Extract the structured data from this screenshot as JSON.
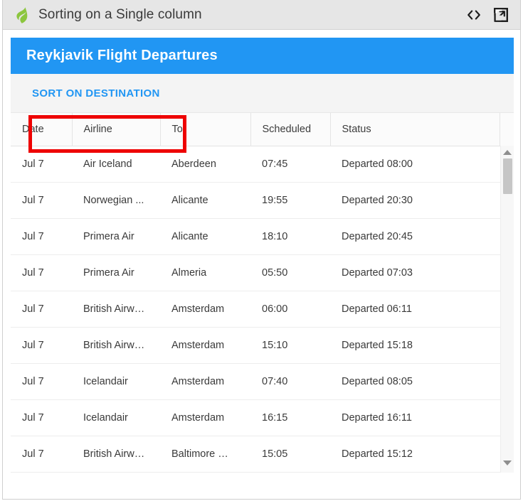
{
  "chrome": {
    "title": "Sorting on a Single column",
    "logo_icon": "green-leaf-logo",
    "actions": [
      {
        "name": "view-source-icon",
        "label": "<>"
      },
      {
        "name": "open-external-icon",
        "label": "open in new window"
      }
    ]
  },
  "panel": {
    "title": "Reykjavik Flight Departures",
    "header_color": "#2196f3",
    "toolbar": {
      "sort_button_label": "SORT ON DESTINATION",
      "sort_button_color": "#2196f3"
    }
  },
  "annotation": {
    "highlight_color": "#ee0000",
    "target": "sort-destination-button"
  },
  "grid": {
    "columns": [
      {
        "key": "date",
        "label": "Date"
      },
      {
        "key": "airline",
        "label": "Airline"
      },
      {
        "key": "to",
        "label": "To"
      },
      {
        "key": "scheduled",
        "label": "Scheduled"
      },
      {
        "key": "status",
        "label": "Status"
      }
    ],
    "rows": [
      {
        "date": "Jul 7",
        "airline": "Air Iceland",
        "to": "Aberdeen",
        "scheduled": "07:45",
        "status": "Departed 08:00"
      },
      {
        "date": "Jul 7",
        "airline": "Norwegian ...",
        "to": "Alicante",
        "scheduled": "19:55",
        "status": "Departed 20:30"
      },
      {
        "date": "Jul 7",
        "airline": "Primera Air",
        "to": "Alicante",
        "scheduled": "18:10",
        "status": "Departed 20:45"
      },
      {
        "date": "Jul 7",
        "airline": "Primera Air",
        "to": "Almeria",
        "scheduled": "05:50",
        "status": "Departed 07:03"
      },
      {
        "date": "Jul 7",
        "airline": "British Airw…",
        "to": "Amsterdam",
        "scheduled": "06:00",
        "status": "Departed 06:11"
      },
      {
        "date": "Jul 7",
        "airline": "British Airw…",
        "to": "Amsterdam",
        "scheduled": "15:10",
        "status": "Departed 15:18"
      },
      {
        "date": "Jul 7",
        "airline": "Icelandair",
        "to": "Amsterdam",
        "scheduled": "07:40",
        "status": "Departed 08:05"
      },
      {
        "date": "Jul 7",
        "airline": "Icelandair",
        "to": "Amsterdam",
        "scheduled": "16:15",
        "status": "Departed 16:11"
      },
      {
        "date": "Jul 7",
        "airline": "British Airw…",
        "to": "Baltimore …",
        "scheduled": "15:05",
        "status": "Departed 15:12"
      }
    ],
    "scrollbar": {
      "up_arrow_icon": "chevron-up-icon",
      "down_arrow_icon": "chevron-down-icon"
    }
  }
}
